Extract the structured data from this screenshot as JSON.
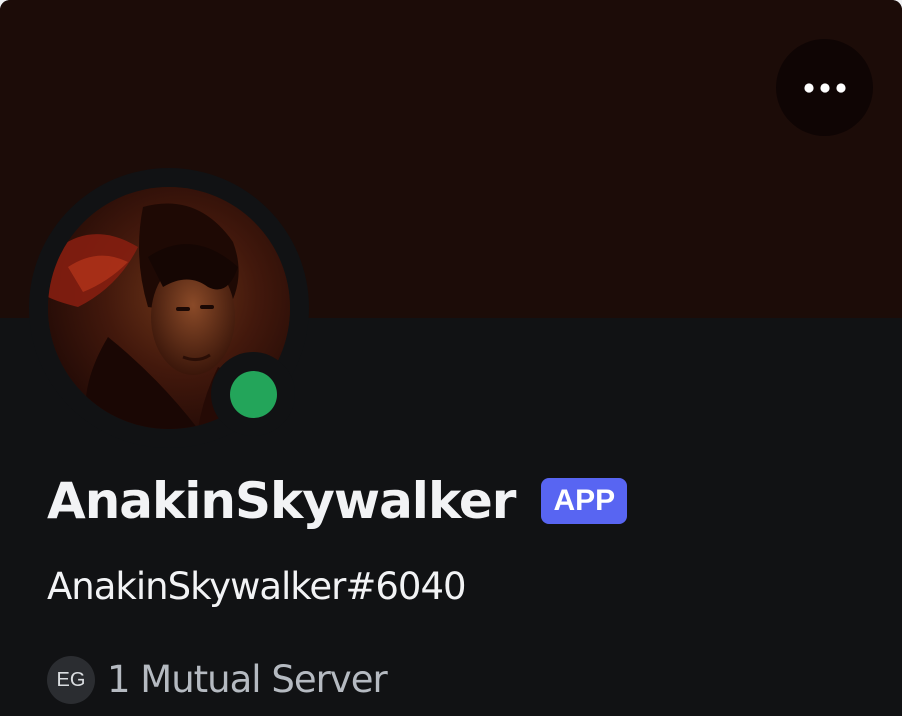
{
  "profile": {
    "display_name": "AnakinSkywalker",
    "badge": "APP",
    "username": "AnakinSkywalker#6040",
    "status": "online"
  },
  "mutual": {
    "server_initials": "EG",
    "label": "1 Mutual Server"
  },
  "icons": {
    "more": "more-options-icon",
    "status": "online-status-icon"
  },
  "colors": {
    "banner": "#1c0c08",
    "background": "#111214",
    "badge": "#5865f2",
    "online": "#23a55a"
  }
}
